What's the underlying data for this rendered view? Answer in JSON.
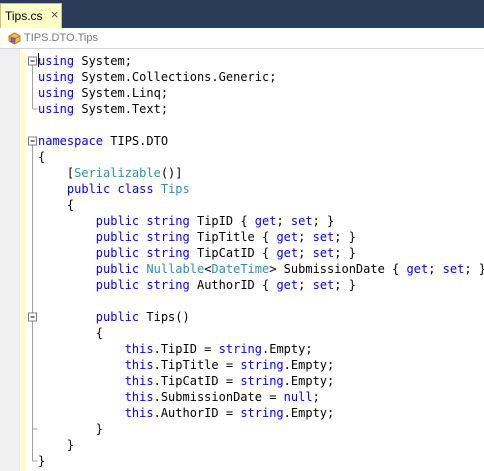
{
  "tab": {
    "title": "Tips.cs",
    "close_glyph": "×"
  },
  "navbar": {
    "type_selector": "TIPS.DTO.Tips",
    "icon": "class-icon"
  },
  "colors": {
    "keyword": "#0000ff",
    "type": "#2b91af",
    "text": "#000000",
    "tab_bg": "#fefcc8",
    "tabstrip_bg": "#2b3c59"
  },
  "code_lines": [
    [
      {
        "t": "using",
        "c": "kw"
      },
      {
        "t": " System;"
      }
    ],
    [
      {
        "t": "using",
        "c": "kw"
      },
      {
        "t": " System.Collections.Generic;"
      }
    ],
    [
      {
        "t": "using",
        "c": "kw"
      },
      {
        "t": " System.Linq;"
      }
    ],
    [
      {
        "t": "using",
        "c": "kw"
      },
      {
        "t": " System.Text;"
      }
    ],
    [],
    [
      {
        "t": "namespace",
        "c": "kw"
      },
      {
        "t": " TIPS.DTO"
      }
    ],
    [
      {
        "t": "{"
      }
    ],
    [
      {
        "t": "    ["
      },
      {
        "t": "Serializable",
        "c": "ty"
      },
      {
        "t": "()]"
      }
    ],
    [
      {
        "t": "    "
      },
      {
        "t": "public",
        "c": "kw"
      },
      {
        "t": " "
      },
      {
        "t": "class",
        "c": "kw"
      },
      {
        "t": " "
      },
      {
        "t": "Tips",
        "c": "ty"
      }
    ],
    [
      {
        "t": "    {"
      }
    ],
    [
      {
        "t": "        "
      },
      {
        "t": "public",
        "c": "kw"
      },
      {
        "t": " "
      },
      {
        "t": "string",
        "c": "kw"
      },
      {
        "t": " TipID { "
      },
      {
        "t": "get",
        "c": "kw"
      },
      {
        "t": "; "
      },
      {
        "t": "set",
        "c": "kw"
      },
      {
        "t": "; }"
      }
    ],
    [
      {
        "t": "        "
      },
      {
        "t": "public",
        "c": "kw"
      },
      {
        "t": " "
      },
      {
        "t": "string",
        "c": "kw"
      },
      {
        "t": " TipTitle { "
      },
      {
        "t": "get",
        "c": "kw"
      },
      {
        "t": "; "
      },
      {
        "t": "set",
        "c": "kw"
      },
      {
        "t": "; }"
      }
    ],
    [
      {
        "t": "        "
      },
      {
        "t": "public",
        "c": "kw"
      },
      {
        "t": " "
      },
      {
        "t": "string",
        "c": "kw"
      },
      {
        "t": " TipCatID { "
      },
      {
        "t": "get",
        "c": "kw"
      },
      {
        "t": "; "
      },
      {
        "t": "set",
        "c": "kw"
      },
      {
        "t": "; }"
      }
    ],
    [
      {
        "t": "        "
      },
      {
        "t": "public",
        "c": "kw"
      },
      {
        "t": " "
      },
      {
        "t": "Nullable",
        "c": "ty"
      },
      {
        "t": "<"
      },
      {
        "t": "DateTime",
        "c": "ty"
      },
      {
        "t": "> SubmissionDate { "
      },
      {
        "t": "get",
        "c": "kw"
      },
      {
        "t": "; "
      },
      {
        "t": "set",
        "c": "kw"
      },
      {
        "t": "; }"
      }
    ],
    [
      {
        "t": "        "
      },
      {
        "t": "public",
        "c": "kw"
      },
      {
        "t": " "
      },
      {
        "t": "string",
        "c": "kw"
      },
      {
        "t": " AuthorID { "
      },
      {
        "t": "get",
        "c": "kw"
      },
      {
        "t": "; "
      },
      {
        "t": "set",
        "c": "kw"
      },
      {
        "t": "; }"
      }
    ],
    [],
    [
      {
        "t": "        "
      },
      {
        "t": "public",
        "c": "kw"
      },
      {
        "t": " Tips()"
      }
    ],
    [
      {
        "t": "        {"
      }
    ],
    [
      {
        "t": "            "
      },
      {
        "t": "this",
        "c": "kw"
      },
      {
        "t": ".TipID = "
      },
      {
        "t": "string",
        "c": "kw"
      },
      {
        "t": ".Empty;"
      }
    ],
    [
      {
        "t": "            "
      },
      {
        "t": "this",
        "c": "kw"
      },
      {
        "t": ".TipTitle = "
      },
      {
        "t": "string",
        "c": "kw"
      },
      {
        "t": ".Empty;"
      }
    ],
    [
      {
        "t": "            "
      },
      {
        "t": "this",
        "c": "kw"
      },
      {
        "t": ".TipCatID = "
      },
      {
        "t": "string",
        "c": "kw"
      },
      {
        "t": ".Empty;"
      }
    ],
    [
      {
        "t": "            "
      },
      {
        "t": "this",
        "c": "kw"
      },
      {
        "t": ".SubmissionDate = "
      },
      {
        "t": "null",
        "c": "kw"
      },
      {
        "t": ";"
      }
    ],
    [
      {
        "t": "            "
      },
      {
        "t": "this",
        "c": "kw"
      },
      {
        "t": ".AuthorID = "
      },
      {
        "t": "string",
        "c": "kw"
      },
      {
        "t": ".Empty;"
      }
    ],
    [
      {
        "t": "        }"
      }
    ],
    [
      {
        "t": "    }"
      }
    ],
    [
      {
        "t": "}"
      }
    ]
  ],
  "collapse_markers": [
    {
      "line": 0,
      "glyph": "−"
    },
    {
      "line": 5,
      "glyph": "−"
    },
    {
      "line": 16,
      "glyph": "−"
    }
  ]
}
